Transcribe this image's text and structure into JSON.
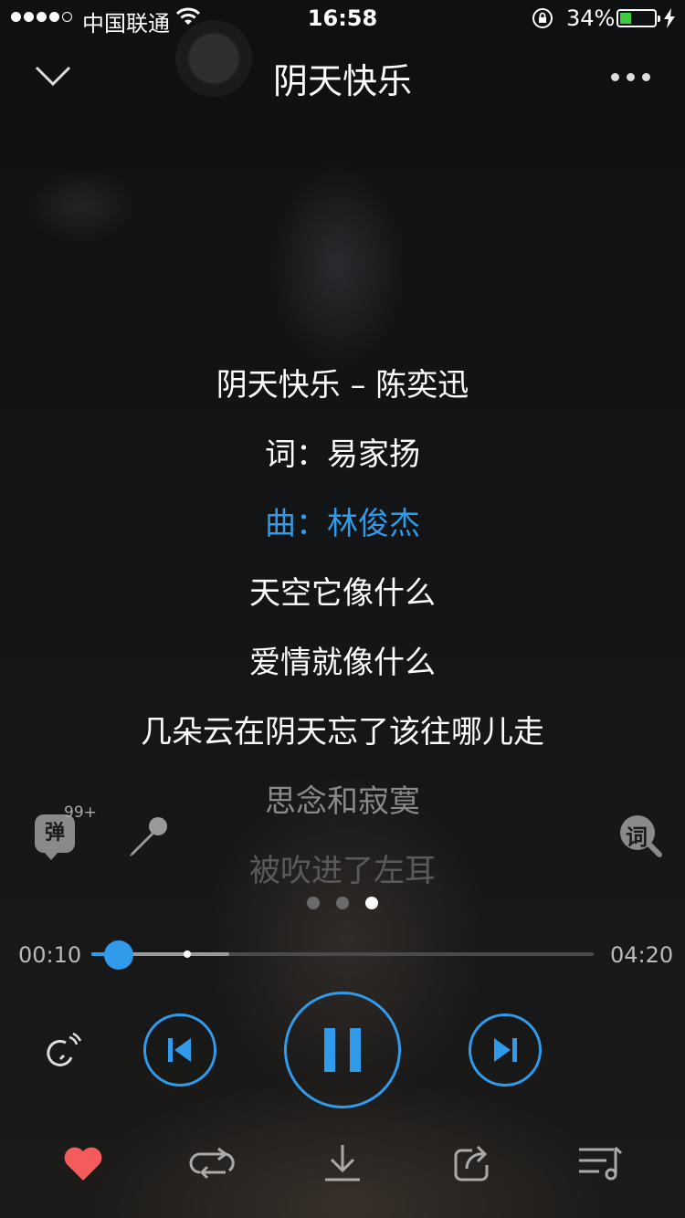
{
  "status_bar": {
    "carrier": "中国联通",
    "time": "16:58",
    "battery_percent": "34%",
    "battery_level": 0.34,
    "signal_bars": 4
  },
  "header": {
    "title": "阴天快乐"
  },
  "lyrics": [
    {
      "text": "阴天快乐 – 陈奕迅",
      "state": "normal"
    },
    {
      "text": "词：易家扬",
      "state": "normal"
    },
    {
      "text": "曲：林俊杰",
      "state": "active"
    },
    {
      "text": "天空它像什么",
      "state": "normal"
    },
    {
      "text": "爱情就像什么",
      "state": "normal"
    },
    {
      "text": "几朵云在阴天忘了该往哪儿走",
      "state": "normal"
    },
    {
      "text": "思念和寂寞",
      "state": "dim1"
    },
    {
      "text": "被吹进了左耳",
      "state": "dim2"
    }
  ],
  "tools": {
    "danmu_label": "弹",
    "danmu_count": "99+",
    "lyric_search_label": "词"
  },
  "pager": {
    "count": 3,
    "active": 2
  },
  "progress": {
    "current_time": "00:10",
    "total_time": "04:20",
    "played_fraction": 0.055,
    "buffered_fraction": 0.275,
    "marker_fraction": 0.19
  },
  "colors": {
    "accent": "#2f9bea",
    "favorite": "#f45b5b",
    "battery": "#3fcd3f"
  },
  "icons": [
    "chevron-down-icon",
    "more-icon",
    "mic-icon",
    "lyric-search-icon",
    "play-mode-icon",
    "prev-icon",
    "pause-icon",
    "next-icon",
    "heart-icon",
    "repeat-icon",
    "download-icon",
    "share-icon",
    "playlist-icon"
  ]
}
